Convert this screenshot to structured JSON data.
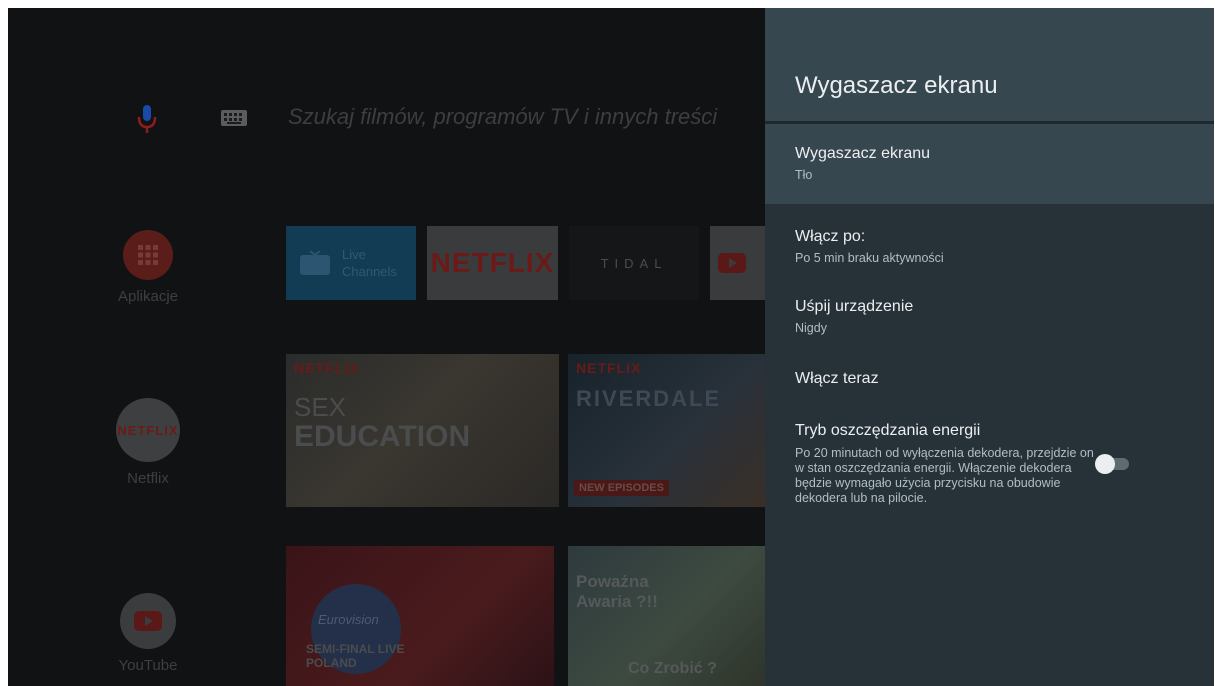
{
  "home": {
    "search_placeholder": "Szukaj filmów, programów TV i innych treści",
    "sidebar": [
      {
        "label": "Aplikacje"
      },
      {
        "label": "Netflix",
        "logo_text": "NETFLIX"
      },
      {
        "label": "YouTube"
      }
    ],
    "apps_row": {
      "live_channels": {
        "line1": "Live",
        "line2": "Channels"
      },
      "netflix": "NETFLIX",
      "tidal": "TIDAL"
    },
    "posters": {
      "sex_education": {
        "brand": "NETFLIX",
        "line1": "SEX",
        "line2": "EDUCATION"
      },
      "riverdale": {
        "brand": "NETFLIX",
        "title": "RIVERDALE",
        "badge": "NEW EPISODES"
      },
      "eurovision": {
        "logo": "Eurovision",
        "caption_line1": "SEMI-FINAL LIVE",
        "caption_line2": "POLAND"
      },
      "awaria": {
        "line1": "Poważna",
        "line2": "Awaria ?!!",
        "bottom": "Co Zrobić ?"
      }
    },
    "colors": {
      "mic_blue": "#1a4aa8",
      "mic_red": "#8b1e1a",
      "netflix_red": "#6b1a18"
    }
  },
  "settings": {
    "title": "Wygaszacz ekranu",
    "rows": [
      {
        "title": "Wygaszacz ekranu",
        "subtitle": "Tło",
        "focused": true
      },
      {
        "title": "Włącz po:",
        "subtitle": "Po 5 min braku aktywności"
      },
      {
        "title": "Uśpij urządzenie",
        "subtitle": "Nigdy"
      },
      {
        "title": "Włącz teraz"
      },
      {
        "title": "Tryb oszczędzania energii",
        "subtitle": "Po 20 minutach od wyłączenia dekodera, przejdzie on w stan oszczędzania energii. Włączenie dekodera będzie wymagało użycia przycisku na obudowie dekodera lub na pilocie.",
        "toggle_on": false
      }
    ],
    "colors": {
      "panel_bg": "#263238",
      "header_bg": "#37474f",
      "text": "#eceff1",
      "subtext": "#b0bec5"
    }
  }
}
